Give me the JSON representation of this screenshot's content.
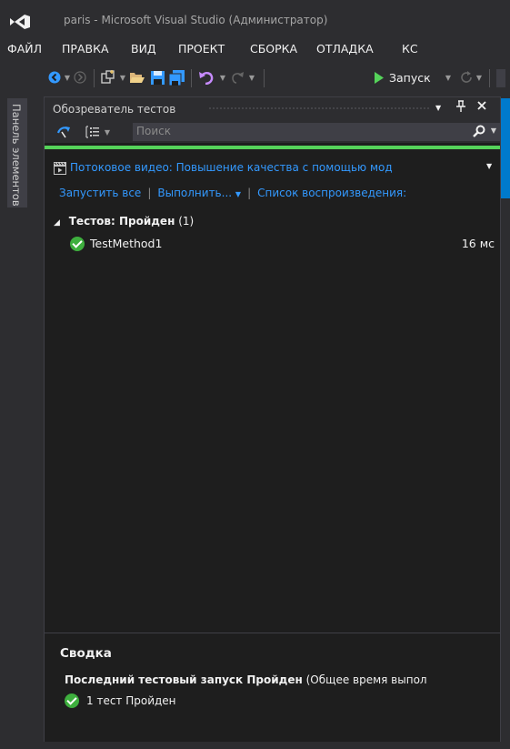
{
  "window": {
    "title": "paris - Microsoft Visual Studio (Администратор)"
  },
  "menu": [
    "ФАЙЛ",
    "ПРАВКА",
    "ВИД",
    "ПРОЕКТ",
    "СБОРКА",
    "ОТЛАДКА",
    "КС"
  ],
  "toolbar": {
    "run_label": "Запуск"
  },
  "sidebar": {
    "toolbox_label": "Панель элементов"
  },
  "test_explorer": {
    "title": "Обозреватель тестов",
    "search_placeholder": "Поиск",
    "playlist_title": "Потоковое видео: Повышение качества с помощью мод",
    "actions": {
      "run_all": "Запустить все",
      "run": "Выполнить...",
      "playlist": "Список воспроизведения:"
    },
    "group": {
      "title": "Тестов: Пройден",
      "count": "(1)"
    },
    "tests": [
      {
        "name": "TestMethod1",
        "duration": "16 мс",
        "status": "passed"
      }
    ],
    "summary": {
      "title": "Сводка",
      "last_run": "Последний тестовый запуск Пройден",
      "total_time": "(Общее время выпол",
      "count": "1 тест Пройден"
    }
  },
  "colors": {
    "accent": "#007acc",
    "link": "#3399ff",
    "pass": "#55d35a",
    "background": "#1e1e1e",
    "chrome": "#2d2d30"
  }
}
